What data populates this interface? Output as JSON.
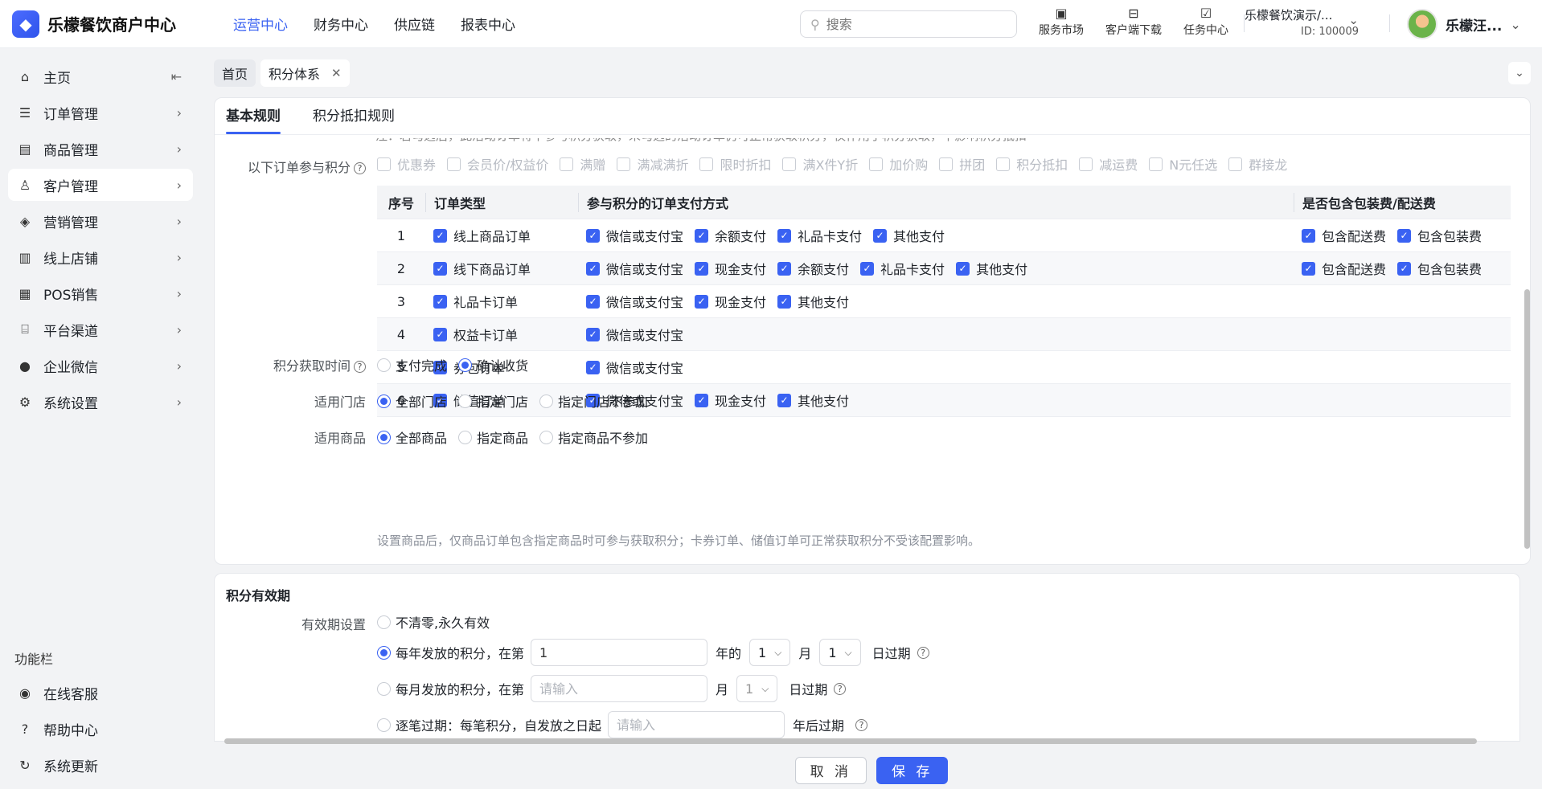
{
  "brand": {
    "name": "乐檬餐饮商户中心"
  },
  "topnav": [
    "运营中心",
    "财务中心",
    "供应链",
    "报表中心"
  ],
  "search": {
    "placeholder": "搜索"
  },
  "topicons": [
    "服务市场",
    "客户端下载",
    "任务中心"
  ],
  "tenant": {
    "name": "乐檬餐饮演示/...",
    "id": "ID: 100009"
  },
  "user": {
    "name": "乐檬汪..."
  },
  "sidebar": {
    "items": [
      "主页",
      "订单管理",
      "商品管理",
      "客户管理",
      "营销管理",
      "线上店铺",
      "POS销售",
      "平台渠道",
      "企业微信",
      "系统设置"
    ],
    "func_title": "功能栏",
    "func_items": [
      "在线客服",
      "帮助中心",
      "系统更新"
    ]
  },
  "tabs": [
    "首页",
    "积分体系"
  ],
  "subtabs": [
    "基本规则",
    "积分抵扣规则"
  ],
  "top_cut_text": "注：若勾选后，此活动订单将不参与积分获取，未勾选的活动订单仍可正常获取积分，仅作用于积分获取，不影响积分抵扣",
  "disabled_promos": [
    "优惠券",
    "会员价/权益价",
    "满赠",
    "满减满折",
    "限时折扣",
    "满X件Y折",
    "加价购",
    "拼团",
    "积分抵扣",
    "减运费",
    "N元任选",
    "群接龙"
  ],
  "order_section": {
    "label": "以下订单参与积分",
    "headers": [
      "序号",
      "订单类型",
      "参与积分的订单支付方式",
      "是否包含包装费/配送费"
    ],
    "rows": [
      {
        "idx": "1",
        "type": "线上商品订单",
        "pays": [
          "微信或支付宝",
          "余额支付",
          "礼品卡支付",
          "其他支付"
        ],
        "fees": [
          "包含配送费",
          "包含包装费"
        ]
      },
      {
        "idx": "2",
        "type": "线下商品订单",
        "pays": [
          "微信或支付宝",
          "现金支付",
          "余额支付",
          "礼品卡支付",
          "其他支付"
        ],
        "fees": [
          "包含配送费",
          "包含包装费"
        ]
      },
      {
        "idx": "3",
        "type": "礼品卡订单",
        "pays": [
          "微信或支付宝",
          "现金支付",
          "其他支付"
        ],
        "fees": []
      },
      {
        "idx": "4",
        "type": "权益卡订单",
        "pays": [
          "微信或支付宝"
        ],
        "fees": []
      },
      {
        "idx": "5",
        "type": "券包订单",
        "pays": [
          "微信或支付宝"
        ],
        "fees": []
      },
      {
        "idx": "6",
        "type": "储值订单",
        "pays": [
          "微信或支付宝",
          "现金支付",
          "其他支付"
        ],
        "fees": []
      }
    ]
  },
  "earn_time": {
    "label": "积分获取时间",
    "options": [
      "支付完成",
      "确认收货"
    ],
    "selected": 1
  },
  "stores": {
    "label": "适用门店",
    "options": [
      "全部门店",
      "指定门店",
      "指定门店不参加"
    ],
    "selected": 0
  },
  "goods": {
    "label": "适用商品",
    "options": [
      "全部商品",
      "指定商品",
      "指定商品不参加"
    ],
    "selected": 0
  },
  "goods_note": "设置商品后，仅商品订单包含指定商品时可参与获取积分；卡券订单、储值订单可正常获取积分不受该配置影响。",
  "validity": {
    "title": "积分有效期",
    "label": "有效期设置",
    "opt1": "不清零,永久有效",
    "opt2_prefix": "每年发放的积分，在第",
    "opt2_value": "1",
    "opt2_year_suffix": "年的",
    "opt2_month": "1",
    "opt2_month_label": "月",
    "opt2_day": "1",
    "opt2_day_suffix": "日过期",
    "opt3_prefix": "每月发放的积分，在第",
    "opt3_placeholder": "请输入",
    "opt3_month_label": "月",
    "opt3_day": "1",
    "opt3_day_suffix": "日过期",
    "opt4_prefix": "逐笔过期：每笔积分，自发放之日起",
    "opt4_placeholder": "请输入",
    "opt4_suffix": "年后过期"
  },
  "footer": {
    "cancel": "取 消",
    "save": "保 存"
  },
  "colors": {
    "accent": "#3a62f2"
  }
}
